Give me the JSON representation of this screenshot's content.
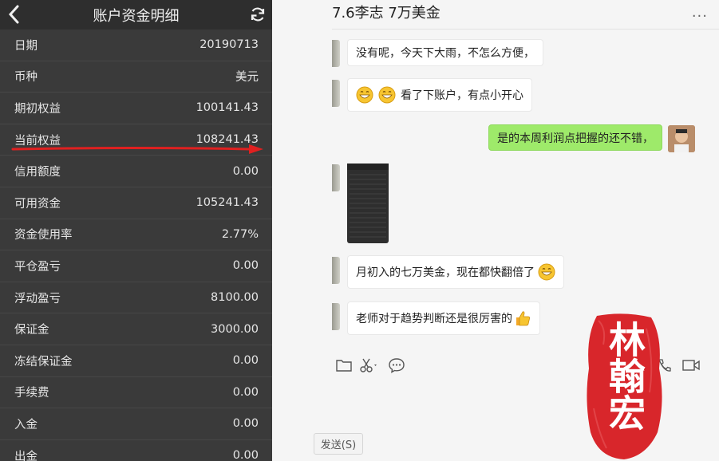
{
  "phone": {
    "title": "账户资金明细",
    "rows": [
      {
        "label": "日期",
        "value": "20190713"
      },
      {
        "label": "币种",
        "value": "美元"
      },
      {
        "label": "期初权益",
        "value": "100141.43"
      },
      {
        "label": "当前权益",
        "value": "108241.43"
      },
      {
        "label": "信用额度",
        "value": "0.00"
      },
      {
        "label": "可用资金",
        "value": "105241.43"
      },
      {
        "label": "资金使用率",
        "value": "2.77%"
      },
      {
        "label": "平仓盈亏",
        "value": "0.00"
      },
      {
        "label": "浮动盈亏",
        "value": "8100.00"
      },
      {
        "label": "保证金",
        "value": "3000.00"
      },
      {
        "label": "冻结保证金",
        "value": "0.00"
      },
      {
        "label": "手续费",
        "value": "0.00"
      },
      {
        "label": "入金",
        "value": "0.00"
      },
      {
        "label": "出金",
        "value": "0.00"
      }
    ]
  },
  "chat": {
    "title": "7.6李志 7万美金",
    "more": "···",
    "messages": [
      {
        "text": "没有呢，今天下大雨，不怎么方便，"
      },
      {
        "text": "看了下账户，有点小开心"
      },
      {
        "text": "是的本周利润点把握的还不错，"
      },
      {
        "text": "月初入的七万美金，现在都快翻倍了"
      },
      {
        "text": "老师对于趋势判断还是很厉害的"
      }
    ],
    "send_label": "发送(S)"
  },
  "stamp": {
    "text": "林翰宏"
  },
  "colors": {
    "phone_bg": "#3a3a3a",
    "my_bubble": "#9eea6a",
    "arrow": "#e02020",
    "stamp": "#d8262b"
  }
}
